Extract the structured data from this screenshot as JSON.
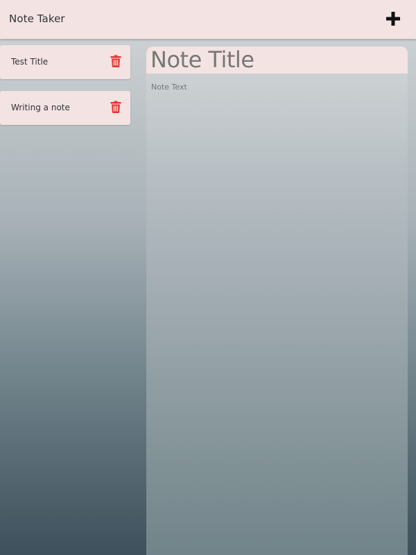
{
  "header": {
    "title": "Note Taker",
    "add_icon": "plus-icon"
  },
  "notes": [
    {
      "title": "Test Title",
      "delete_icon": "trash-icon"
    },
    {
      "title": "Writing a note",
      "delete_icon": "trash-icon"
    }
  ],
  "editor": {
    "title_placeholder": "Note Title",
    "text_placeholder": "Note Text"
  },
  "colors": {
    "header_bg": "#f3e3e3",
    "card_bg": "#f3e3e3",
    "delete_icon": "#e53935",
    "add_icon": "#111111",
    "background_top": "#d4d7d8",
    "background_bottom": "#3d505b"
  }
}
